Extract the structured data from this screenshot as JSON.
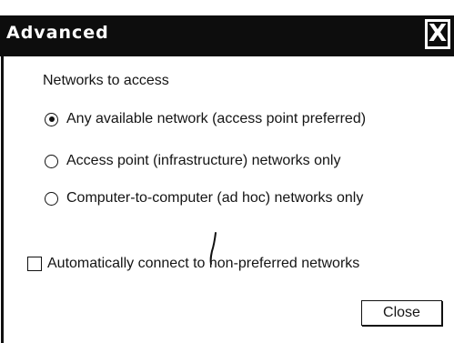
{
  "window": {
    "title": "Advanced",
    "close_glyph": "X"
  },
  "networks_group": {
    "heading": "Networks to access",
    "options": [
      {
        "label": "Any available network (access point preferred)",
        "selected": true
      },
      {
        "label": "Access point (infrastructure) networks only",
        "selected": false
      },
      {
        "label": "Computer-to-computer (ad hoc) networks only",
        "selected": false
      }
    ]
  },
  "auto_connect": {
    "label": "Automatically connect to non-preferred networks",
    "checked": false
  },
  "buttons": {
    "close_label": "Close"
  },
  "colors": {
    "titlebar": "#0d0d0d",
    "title_text": "#ffffff",
    "background": "#ffffff",
    "ink": "#111111"
  },
  "icons": {
    "close": "close-icon",
    "radio_selected": "radio-selected-icon",
    "radio_unselected": "radio-unselected-icon",
    "checkbox": "checkbox-unchecked-icon"
  }
}
